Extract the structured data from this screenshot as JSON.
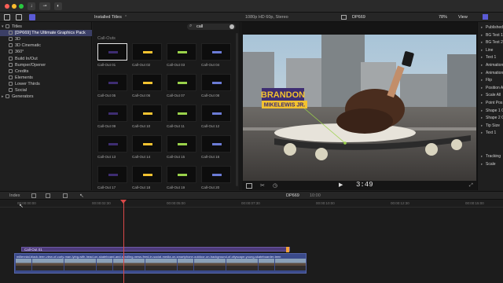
{
  "toolbar": {
    "library_label": "Installed Titles",
    "format": "1080p HD 60p, Stereo",
    "project_name": "DP669",
    "zoom": "78%",
    "view_label": "View",
    "search_value": "call",
    "search_placeholder": "Search"
  },
  "sidebar": {
    "items": [
      {
        "label": "Titles",
        "level": 0
      },
      {
        "label": "[DP669] The Ultimate Graphics Pack",
        "level": 1
      },
      {
        "label": "3D",
        "level": 1
      },
      {
        "label": "3D Cinematic",
        "level": 1
      },
      {
        "label": "360°",
        "level": 1
      },
      {
        "label": "Build In/Out",
        "level": 1
      },
      {
        "label": "Bumper/Opener",
        "level": 1
      },
      {
        "label": "Credits",
        "level": 1
      },
      {
        "label": "Elements",
        "level": 1
      },
      {
        "label": "Lower Thirds",
        "level": 1
      },
      {
        "label": "Social",
        "level": 1
      },
      {
        "label": "Generators",
        "level": 0
      }
    ]
  },
  "browser": {
    "section": "Call-Outs",
    "items": [
      "Call-Out 01",
      "Call-Out 02",
      "Call-Out 03",
      "Call-Out 04",
      "Call-Out 05",
      "Call-Out 06",
      "Call-Out 07",
      "Call-Out 08",
      "Call-Out 09",
      "Call-Out 10",
      "Call-Out 11",
      "Call-Out 12",
      "Call-Out 13",
      "Call-Out 14",
      "Call-Out 15",
      "Call-Out 16",
      "Call-Out 17",
      "Call-Out 18",
      "Call-Out 19",
      "Call-Out 20"
    ]
  },
  "viewer": {
    "title_line1": "BRANDON",
    "title_line2": "MIKELEWIS JR.",
    "timecode": "3:49"
  },
  "inspector": {
    "items": [
      "Published",
      "BG Text 1",
      "BG Text 2",
      "Line",
      "Text 1",
      "Animation",
      "Animation",
      "Flip",
      "Position A",
      "Scale All",
      "Point Pos",
      "Shape 1 C",
      "Shape 2 C",
      "Tip Size",
      "Text 1",
      "Tracking",
      "Scale"
    ]
  },
  "timeline": {
    "index_label": "Index",
    "project": "DP669",
    "duration": "10:00",
    "ruler": [
      "00:00:00:00",
      "00:00:02:30",
      "00:00:05:00",
      "00:00:07:30",
      "00:00:10:00",
      "00:00:12:30",
      "00:00:15:00"
    ],
    "title_clip": "Call-Out 01",
    "video_clip": "millennial-black-teen-view-of-curly-man-lying-with-head-on-skateboard-and-scrolling-news-feed-in-social-media-on-smartphone-outdoor-on-background-of-cityscape-young-skateboarder-teen"
  },
  "colors": {
    "accent": "#5b5bd6",
    "title_clip": "#4d3a7a",
    "video_clip": "#3a4a8a",
    "playhead": "#d94848",
    "selection": "#3b3f66",
    "lower_third_gold": "#f2c230",
    "lower_third_purple": "#3e2d72"
  }
}
